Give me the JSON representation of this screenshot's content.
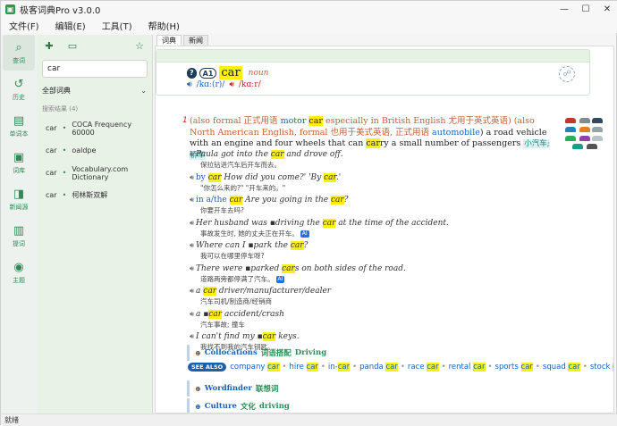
{
  "window": {
    "title": "极客词典Pro v3.0.0",
    "controls": [
      "—",
      "☐",
      "✕"
    ]
  },
  "menu": [
    "文件(F)",
    "编辑(E)",
    "工具(T)",
    "帮助(H)"
  ],
  "nav": [
    {
      "label": "查词",
      "icon": "search-icon",
      "glyph": "⌕"
    },
    {
      "label": "历史",
      "icon": "history-icon",
      "glyph": "↺"
    },
    {
      "label": "单词本",
      "icon": "notebook-icon",
      "glyph": "▤"
    },
    {
      "label": "词库",
      "icon": "word-library-icon",
      "glyph": "▣"
    },
    {
      "label": "新闻源",
      "icon": "news-icon",
      "glyph": "◨"
    },
    {
      "label": "提词",
      "icon": "prompt-icon",
      "glyph": "▥"
    },
    {
      "label": "主题",
      "icon": "theme-icon",
      "glyph": "◉"
    }
  ],
  "list_panel": {
    "search_value": "car",
    "dict_selector": "全部词典",
    "section_label": "搜索结果 (4)",
    "results": [
      {
        "word": "car",
        "dict": "COCA Frequency 60000"
      },
      {
        "word": "car",
        "dict": "oaldpe"
      },
      {
        "word": "car",
        "dict": "Vocabulary.com Dictionary"
      },
      {
        "word": "car",
        "dict": "柯林斯双解"
      }
    ]
  },
  "tabs": [
    "词典",
    "新闻"
  ],
  "entry": {
    "badge_ox": "?",
    "level": "A1",
    "headword": "car",
    "pos": "noun",
    "pron_br": "/kɑː(r)/",
    "pron_am": "/kɑːr/",
    "def_marker": "1",
    "def_parts": {
      "p1": "(also ",
      "formal": "formal",
      "zh_formal": " 正式用语 ",
      "motor": "motor ",
      "car": "car",
      "p2": " especially in British English ",
      "zh_br": "尤用于英式英语",
      "p3": ") (also North American English, formal ",
      "zh_na": "也用于美式英语, 正式用语",
      "auto": " automobile",
      "p4": ") a road vehicle with an engine and four wheels that can ",
      "carry": "car",
      "ry": "ry a small number of passengers ",
      "zh_tag": "小汽车; 轿车"
    },
    "examples": [
      {
        "pre": "Paula got into the ",
        "hl": "car",
        "post": " and drove off.",
        "zh": "保拉钻进汽车后开车而去。",
        "ai": false
      },
      {
        "phrase": "by ",
        "hl": "car",
        "post": " How did you come?' 'By ",
        "hl2": "car",
        "post2": ".'",
        "zh": "\"你怎么来的?\" \"开车来的。\"",
        "ai": false
      },
      {
        "phrase": "in a/the ",
        "hl": "car",
        "post": " Are you going in the ",
        "hl2": "car",
        "post2": "?",
        "zh": "你要开车去吗?",
        "ai": false
      },
      {
        "pre": "Her husband was ▪driving the ",
        "hl": "car",
        "post": " at the time of the accident.",
        "zh": "事故发生时, 她的丈夫正在开车。",
        "ai": true
      },
      {
        "pre": "Where can I ▪park the ",
        "hl": "car",
        "post": "?",
        "zh": "我可以在哪里停车呀?",
        "ai": false
      },
      {
        "pre": "There were ▪parked ",
        "hl": "car",
        "post": "s on both sides of the road.",
        "zh": "道路两旁都停满了汽车。",
        "ai": true
      },
      {
        "pre": "a ",
        "hl": "car",
        "post": " driver/manufacturer/dealer",
        "zh": "汽车司机/制造商/经销商",
        "ai": false
      },
      {
        "pre": "a ▪",
        "hl": "car",
        "post": " accident/crash",
        "zh": "汽车事故; 撞车",
        "ai": false
      },
      {
        "pre": "I can't find my ▪",
        "hl": "car",
        "post": " keys.",
        "zh": "我找不到我的汽车钥匙。",
        "ai": false
      }
    ],
    "ai_label": "AI",
    "sections": {
      "collocations": {
        "en": "Collocations",
        "zh": "词语搭配",
        "tail": "Driving"
      },
      "wordfinder": {
        "en": "Wordfinder",
        "zh": "联想词"
      },
      "culture": {
        "en": "Culture",
        "zh": "文化",
        "tail": "driving"
      }
    },
    "see_also": {
      "badge": "SEE ALSO",
      "items": [
        {
          "pre": "company ",
          "hl": "car",
          "post": ""
        },
        {
          "pre": "hire ",
          "hl": "car",
          "post": ""
        },
        {
          "pre": "in-",
          "hl": "car",
          "post": ""
        },
        {
          "pre": "panda ",
          "hl": "car",
          "post": ""
        },
        {
          "pre": "race ",
          "hl": "car",
          "post": ""
        },
        {
          "pre": "rental ",
          "hl": "car",
          "post": ""
        },
        {
          "pre": "sports ",
          "hl": "car",
          "post": ""
        },
        {
          "pre": "squad ",
          "hl": "car",
          "post": ""
        },
        {
          "pre": "stock ",
          "hl": "car",
          "post": ""
        }
      ]
    }
  },
  "status": "就绪",
  "colors": {
    "accent": "#2e8b57",
    "highlight": "#fff200",
    "link": "#2060b0"
  }
}
